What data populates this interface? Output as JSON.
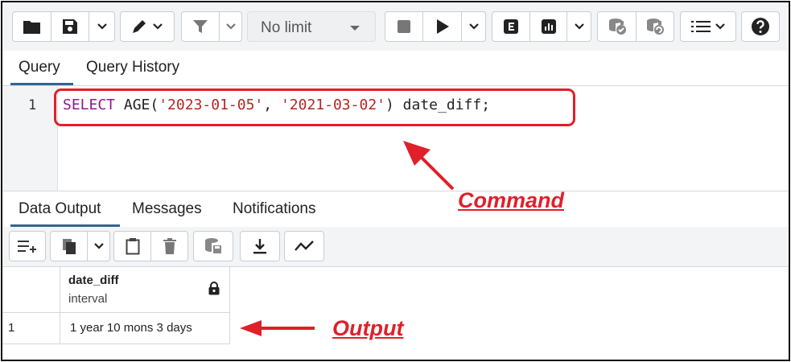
{
  "toolbar": {
    "icons": [
      "folder-open-icon",
      "save-icon",
      "chevron-down-icon",
      "edit-pen-icon",
      "filter-icon",
      "stop-icon",
      "play-icon",
      "explain-icon",
      "explain-analyze-icon",
      "commit-icon",
      "rollback-icon",
      "macros-icon",
      "help-icon"
    ],
    "limit_value": "No limit"
  },
  "editor_tabs": {
    "query": "Query",
    "history": "Query History"
  },
  "editor": {
    "line_number": "1",
    "tokens": {
      "kw_select": "SELECT",
      "fn_age": " AGE(",
      "str1": "'2023-01-05'",
      "sep": ", ",
      "str2": "'2021-03-02'",
      "rest": ") date_diff;"
    }
  },
  "annotations": {
    "command": "Command",
    "output": "Output",
    "accent": "#e0202a"
  },
  "result_tabs": {
    "data_output": "Data Output",
    "messages": "Messages",
    "notifications": "Notifications"
  },
  "grid": {
    "column": {
      "name": "date_diff",
      "type": "interval"
    },
    "rows": [
      {
        "num": "1",
        "value": "1 year 10 mons 3 days"
      }
    ]
  },
  "colors": {
    "tab_underline": "#326690",
    "keyword": "#8a1a8f",
    "string": "#b42525"
  }
}
